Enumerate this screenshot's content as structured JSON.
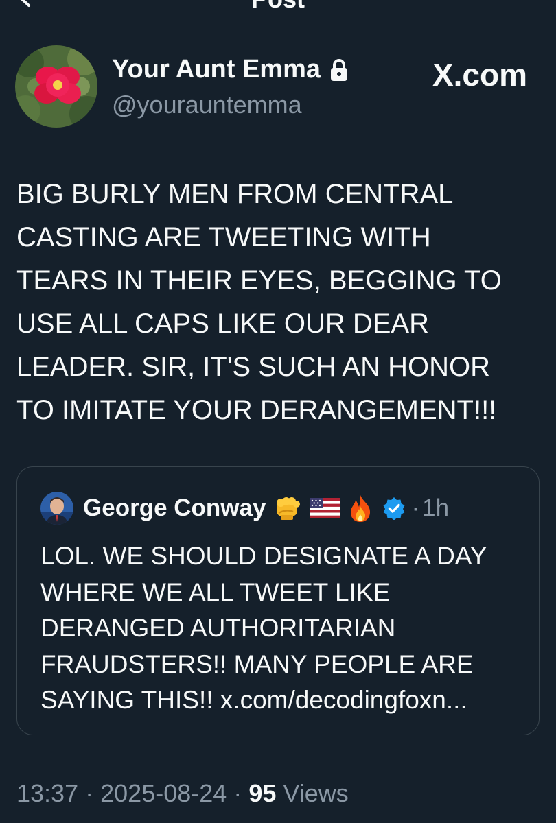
{
  "header": {
    "title": "Post"
  },
  "author": {
    "display_name": "Your Aunt Emma",
    "handle": "@yourauntemma",
    "protected": true
  },
  "brand": "X.com",
  "post": {
    "lines": [
      "BIG BURLY MEN FROM CENTRAL",
      "CASTING ARE TWEETING WITH",
      "TEARS IN THEIR EYES, BEGGING TO",
      "USE ALL CAPS LIKE OUR DEAR",
      "LEADER. SIR, IT'S SUCH AN HONOR",
      "TO IMITATE YOUR DERANGEMENT!!!"
    ]
  },
  "quoted": {
    "name": "George Conway",
    "emojis": [
      "fist-emoji",
      "us-flag-emoji",
      "fire-emoji"
    ],
    "verified": true,
    "separator": "·",
    "time": "1h",
    "lines": [
      "LOL.  WE SHOULD DESIGNATE A DAY",
      "WHERE WE ALL TWEET LIKE",
      "DERANGED AUTHORITARIAN",
      "FRAUDSTERS!!  MANY PEOPLE ARE",
      "SAYING THIS!! x.com/decodingfoxn..."
    ]
  },
  "footer": {
    "time": "13:37",
    "date": "2025-08-24",
    "sep": "·",
    "views_count": "95",
    "views_label": "Views"
  },
  "colors": {
    "background": "#15202b",
    "text": "#f7f9f9",
    "secondary": "#8b98a5",
    "border": "#38444d",
    "verified": "#1d9bf0"
  }
}
